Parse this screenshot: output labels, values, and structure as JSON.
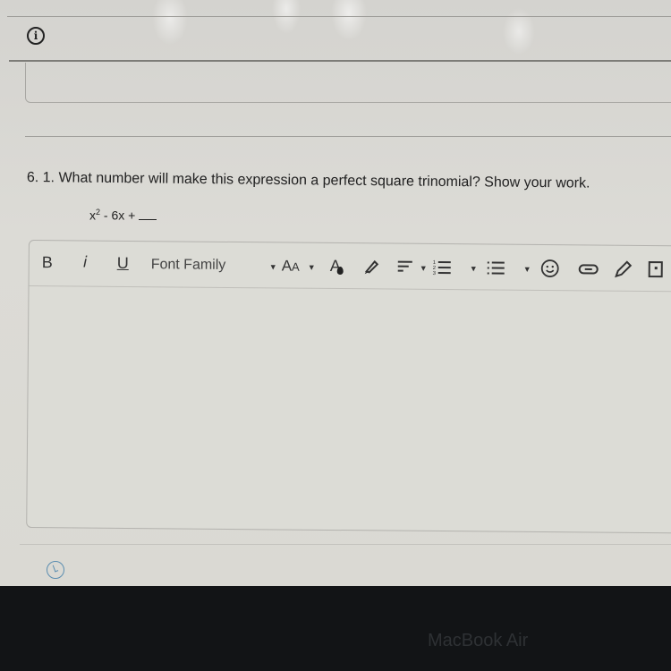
{
  "page": {
    "question": "6. 1. What number will make this expression a perfect square trinomial?  Show your work.",
    "expression": {
      "base": "x",
      "exponent": "2",
      "rest": " - 6x +"
    }
  },
  "editor": {
    "toolbar": {
      "bold_label": "B",
      "italic_label": "i",
      "underline_label": "U",
      "font_family_label": "Font Family",
      "font_size_label_big": "A",
      "font_size_label_small": "A",
      "font_color_label": "A"
    },
    "icons": [
      "bold",
      "italic",
      "underline",
      "font-family-dropdown",
      "font-size",
      "font-color",
      "highlight",
      "align",
      "numbered-list",
      "bullet-list",
      "emoji",
      "link",
      "pencil",
      "image"
    ],
    "content": ""
  },
  "device": {
    "brand": "MacBook Air"
  }
}
